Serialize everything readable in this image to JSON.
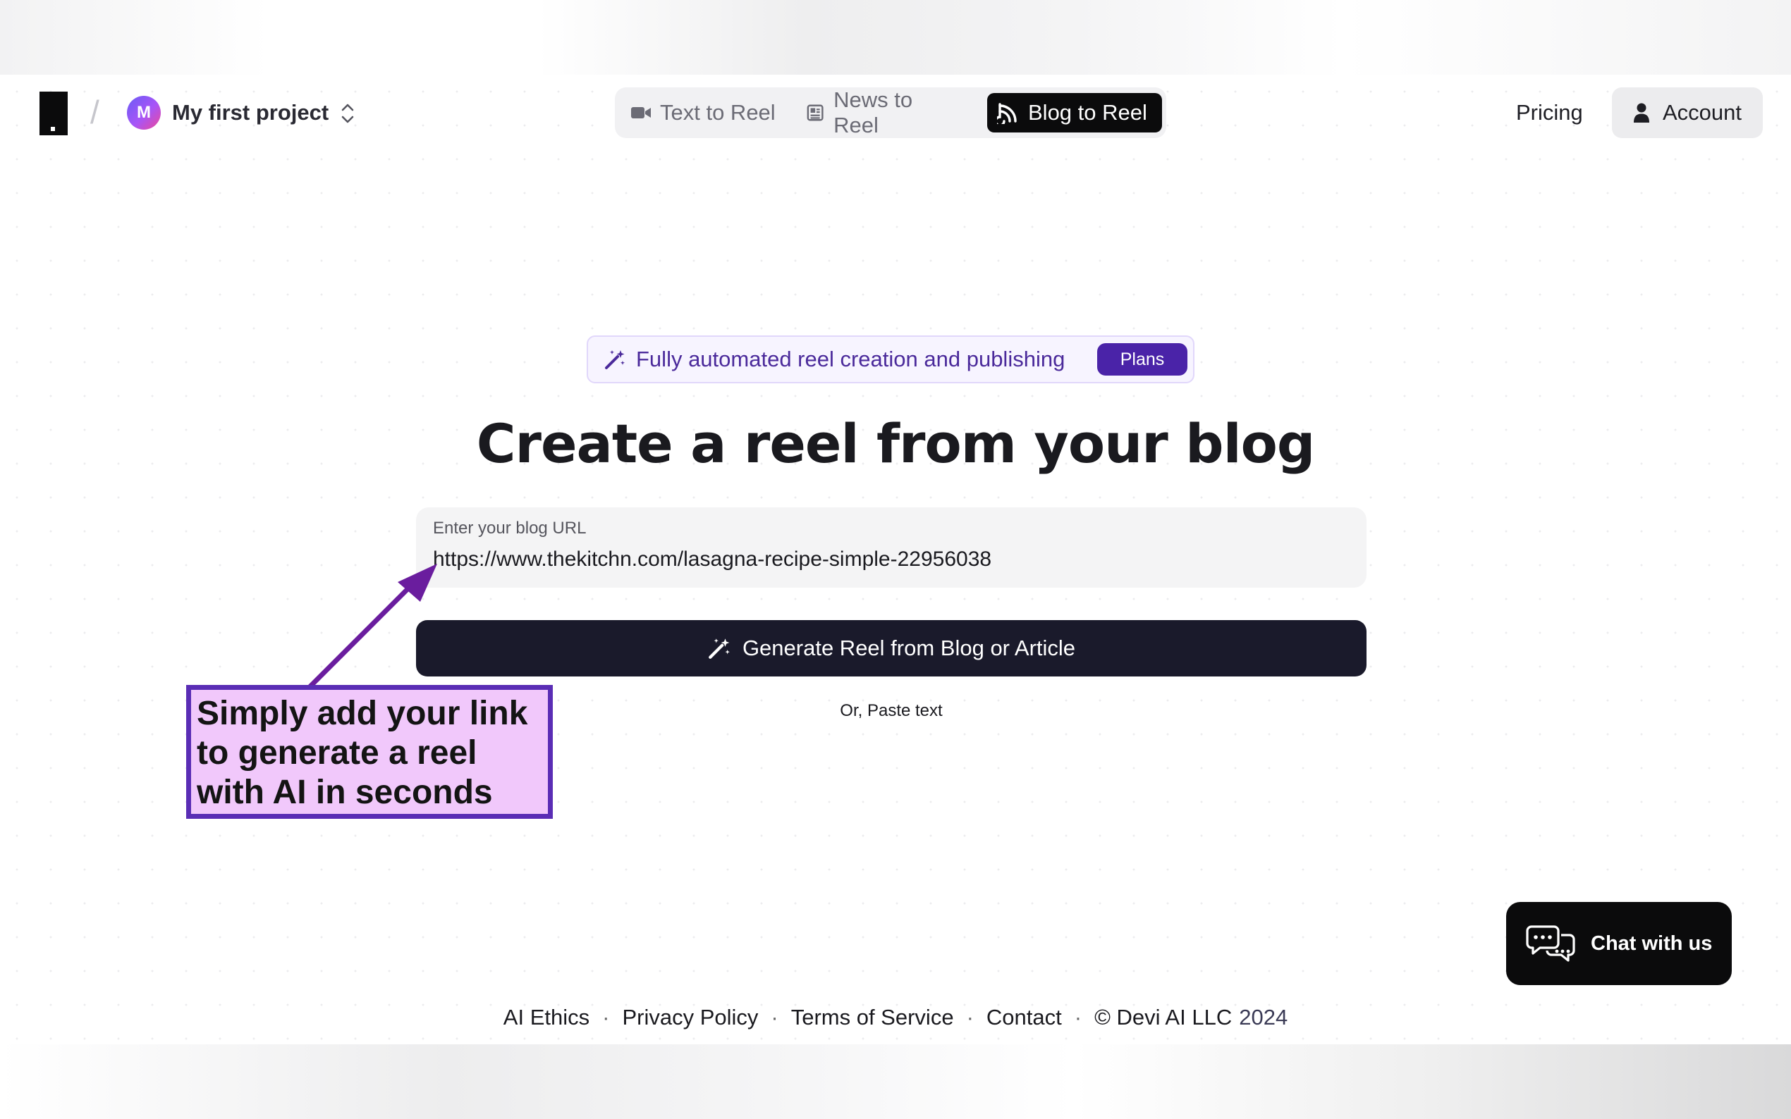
{
  "header": {
    "project_avatar_letter": "M",
    "project_name": "My first project",
    "tabs": [
      {
        "label": "Text to Reel",
        "icon": "video-camera-icon",
        "active": false
      },
      {
        "label": "News to Reel",
        "icon": "newspaper-icon",
        "active": false
      },
      {
        "label": "Blog to Reel",
        "icon": "rss-feed-icon",
        "active": true
      }
    ],
    "pricing_label": "Pricing",
    "account_label": "Account"
  },
  "promo": {
    "text": "Fully automated reel creation and publishing",
    "badge": "Plans"
  },
  "hero": {
    "title": "Create a reel from your blog"
  },
  "url_field": {
    "label": "Enter your blog URL",
    "value": "https://www.thekitchn.com/lasagna-recipe-simple-22956038"
  },
  "generate_button_label": "Generate Reel from Blog or Article",
  "paste_text_label": "Or, Paste text",
  "annotation": {
    "text": "Simply add your link to generate a reel with AI in seconds"
  },
  "chat_label": "Chat with us",
  "footer": {
    "links": [
      "AI Ethics",
      "Privacy Policy",
      "Terms of Service",
      "Contact"
    ],
    "copyright": "© Devi AI LLC",
    "year": "2024"
  },
  "colors": {
    "accent_purple": "#4a23a8",
    "dark_button": "#1a1a2b",
    "active_tab": "#0b0b0c",
    "callout_fill": "#f1c8fb",
    "callout_border": "#5a2db5"
  }
}
